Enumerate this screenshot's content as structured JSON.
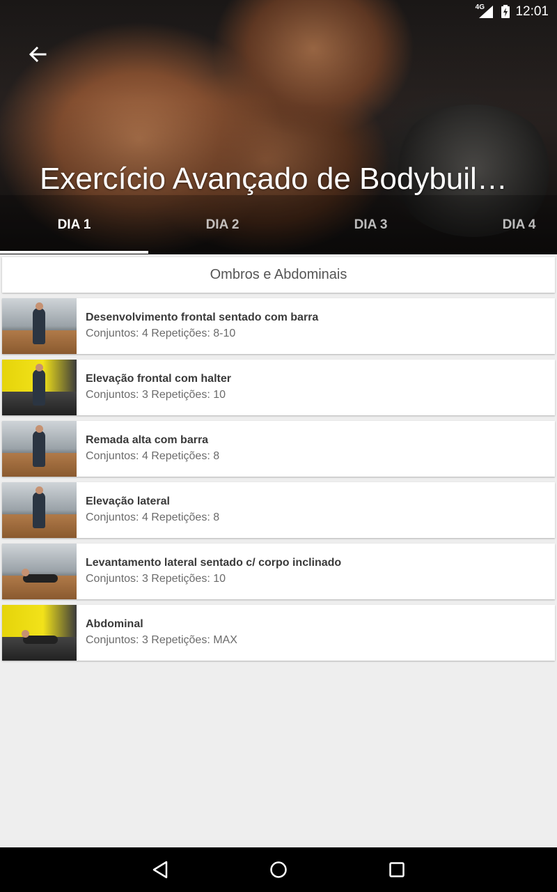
{
  "status_bar": {
    "network": "4G",
    "time": "12:01"
  },
  "header": {
    "title": "Exercício Avançado de Bodybuilding",
    "back_icon": "arrow-back-icon"
  },
  "tabs": [
    {
      "label": "DIA 1",
      "active": true
    },
    {
      "label": "DIA 2",
      "active": false
    },
    {
      "label": "DIA 3",
      "active": false
    },
    {
      "label": "DIA 4",
      "active": false
    }
  ],
  "section": {
    "title": "Ombros e Abdominais"
  },
  "exercises": [
    {
      "name": "Desenvolvimento frontal sentado com barra",
      "details": "Conjuntos: 4 Repetições: 8-10"
    },
    {
      "name": "Elevação frontal com halter",
      "details": "Conjuntos: 3 Repetições: 10"
    },
    {
      "name": "Remada alta com barra",
      "details": "Conjuntos: 4 Repetições: 8"
    },
    {
      "name": "Elevação lateral",
      "details": "Conjuntos: 4 Repetições: 8"
    },
    {
      "name": "Levantamento lateral sentado c/ corpo inclinado",
      "details": "Conjuntos: 3 Repetições: 10"
    },
    {
      "name": "Abdominal",
      "details": "Conjuntos: 3 Repetições: MAX"
    }
  ],
  "colors": {
    "background": "#eeeeee",
    "card": "#ffffff",
    "tab_indicator": "#ffffff",
    "nav_bar": "#000000"
  }
}
